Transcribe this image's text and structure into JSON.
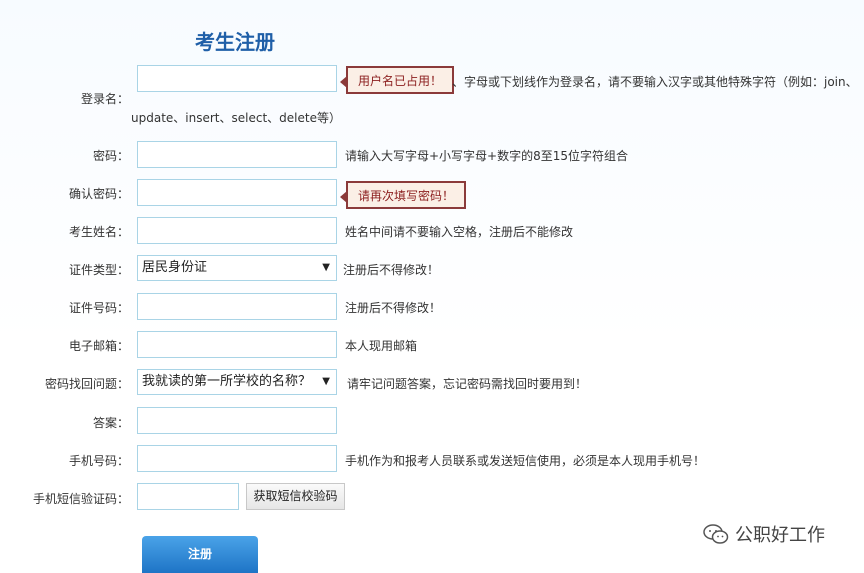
{
  "page": {
    "title": "考生注册"
  },
  "form": {
    "username": {
      "label": "登录名：",
      "value": "",
      "tip": "用户名已占用！",
      "hint_line1": "、字母或下划线作为登录名，请不要输入汉字或其他特殊字符（例如：join、",
      "hint_line2": "update、insert、select、delete等）"
    },
    "password": {
      "label": "密码：",
      "value": "",
      "hint": "请输入大写字母+小写字母+数字的8至15位字符组合"
    },
    "confirm": {
      "label": "确认密码：",
      "value": "",
      "tip": "请再次填写密码！"
    },
    "name": {
      "label": "考生姓名：",
      "value": "",
      "hint": "姓名中间请不要输入空格，注册后不能修改"
    },
    "id_type": {
      "label": "证件类型：",
      "selected": "居民身份证",
      "hint": "注册后不得修改！"
    },
    "id_number": {
      "label": "证件号码：",
      "value": "",
      "hint": "注册后不得修改！"
    },
    "email": {
      "label": "电子邮箱：",
      "value": "",
      "hint": "本人现用邮箱"
    },
    "security_q": {
      "label": "密码找回问题：",
      "selected": "我就读的第一所学校的名称？",
      "hint": "请牢记问题答案，忘记密码需找回时要用到！"
    },
    "answer": {
      "label": "答案：",
      "value": ""
    },
    "phone": {
      "label": "手机号码：",
      "value": "",
      "hint": "手机作为和报考人员联系或发送短信使用，必须是本人现用手机号！"
    },
    "sms": {
      "label": "手机短信验证码：",
      "value": "",
      "button": "获取短信校验码"
    },
    "submit": "注册"
  },
  "watermark": {
    "text": "公职好工作",
    "icon": "wechat-icon"
  }
}
